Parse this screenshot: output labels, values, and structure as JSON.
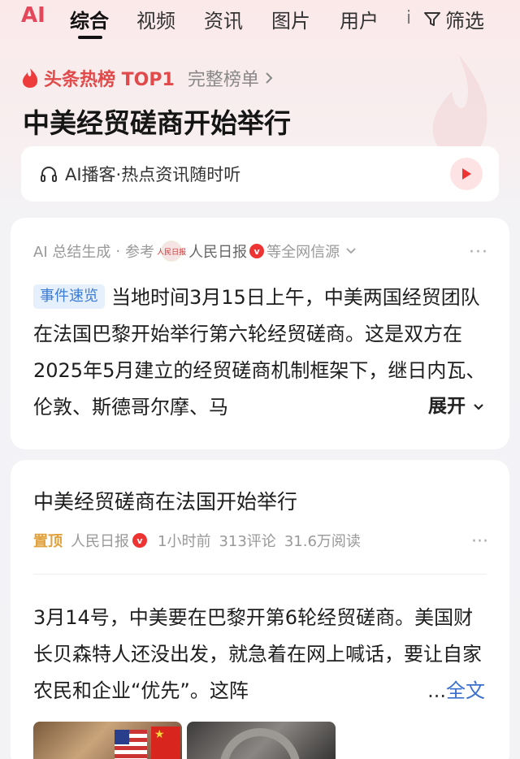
{
  "tabs": {
    "ai": "AI",
    "items": [
      "综合",
      "视频",
      "资讯",
      "图片",
      "用户"
    ],
    "more": "i",
    "filter": "筛选"
  },
  "hot": {
    "title": "头条热榜 TOP1",
    "full_list": "完整榜单",
    "headline": "中美经贸磋商开始举行"
  },
  "podcast": {
    "label": "AI播客·热点资讯随时听"
  },
  "summary_card": {
    "meta_ai": "AI 总结生成",
    "meta_ref": "参考",
    "source_logo": "人民日报",
    "source": "人民日报",
    "verified": "v",
    "all_sources": "等全网信源",
    "tag": "事件速览",
    "text": "当地时间3月15日上午，中美两国经贸团队在法国巴黎开始举行第六轮经贸磋商。这是双方在2025年5月建立的经贸磋商机制框架下，继日内瓦、伦敦、斯德哥尔摩、马",
    "expand": "展开",
    "more": "···"
  },
  "article_card": {
    "title": "中美经贸磋商在法国开始举行",
    "pinned": "置顶",
    "source": "人民日报",
    "verified": "v",
    "time": "1小时前",
    "comments": "313评论",
    "reads": "31.6万阅读",
    "more": "···",
    "body": "3月14号，中美要在巴黎开第6轮经贸磋商。美国财长贝森特人还没出发，就急着在网上喊话，要让自家农民和企业“优先”。这阵",
    "ellipsis": "...",
    "full_text": "全文"
  },
  "colors": {
    "accent_red": "#e14a4a",
    "link_blue": "#3a6fd0",
    "tag_blue": "#3a7bd5",
    "pin_orange": "#e0a13c"
  }
}
